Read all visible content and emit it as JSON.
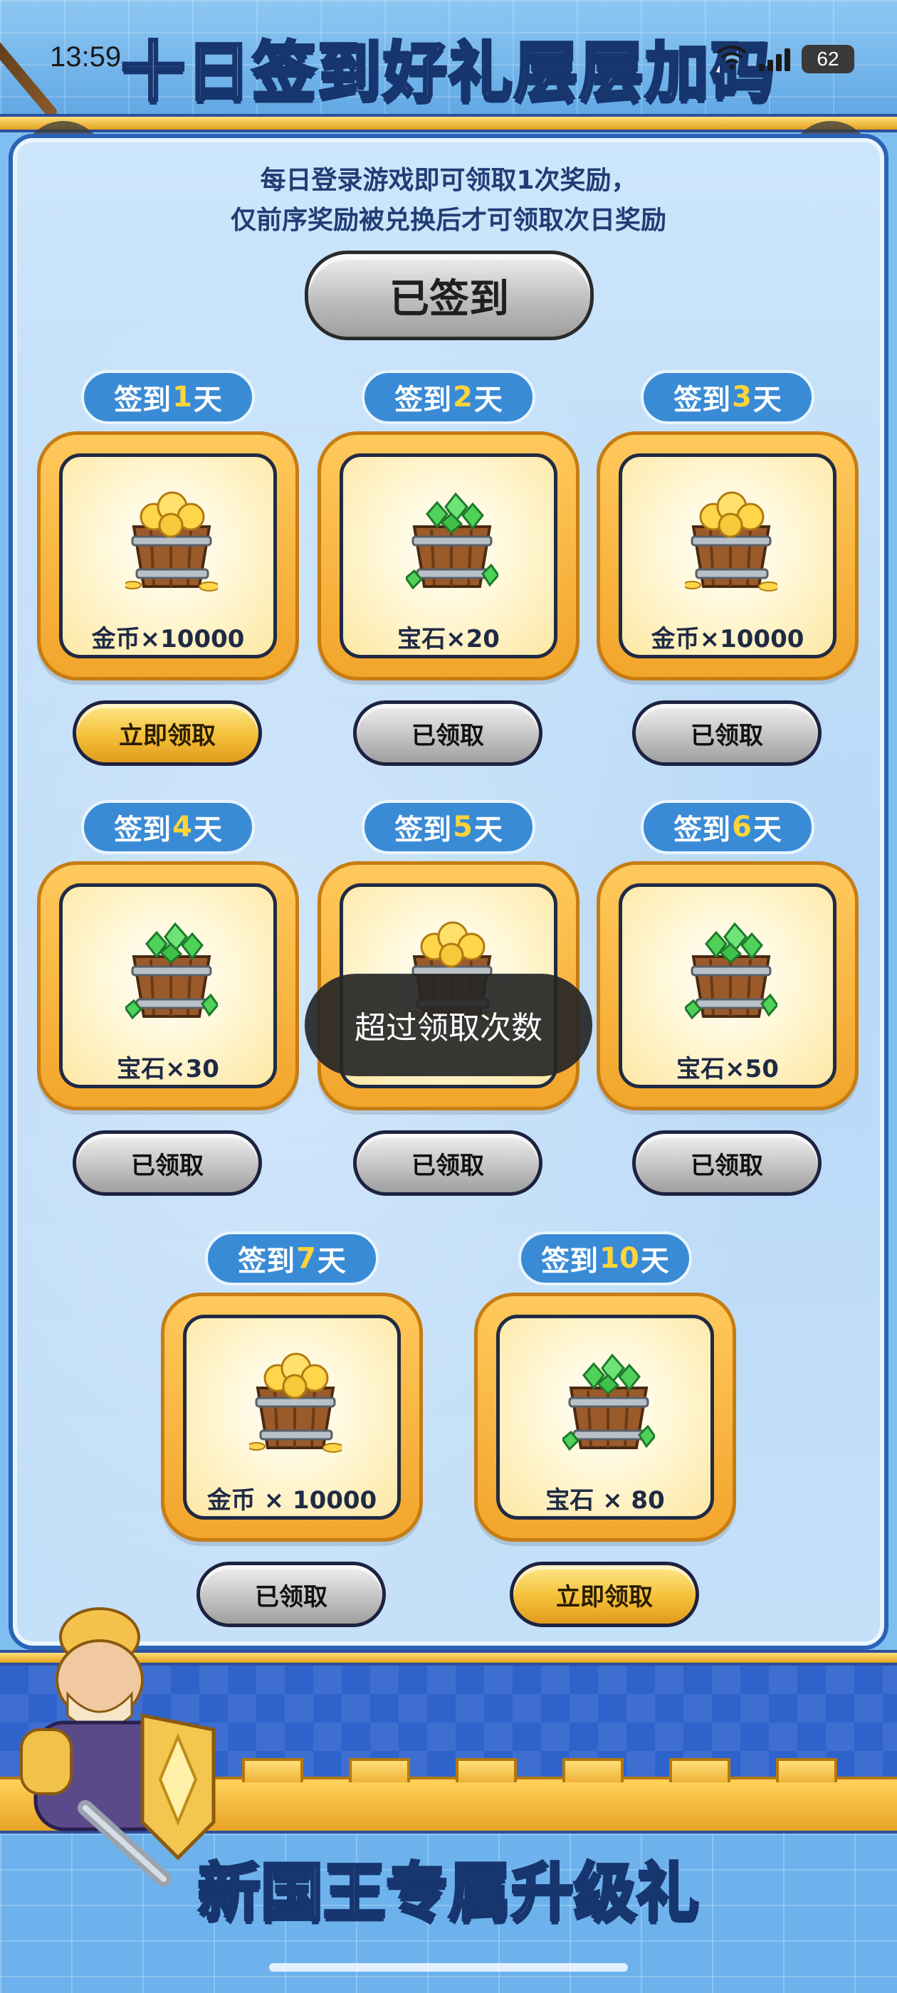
{
  "status_bar": {
    "time": "13:59",
    "battery": "62"
  },
  "banner": {
    "title": "十日签到好礼层层加码"
  },
  "notice": {
    "line1": "每日登录游戏即可领取1次奖励，",
    "line2": "仅前序奖励被兑换后才可领取次日奖励"
  },
  "signed_button": "已签到",
  "days": [
    {
      "prefix": "签到",
      "num": "1",
      "suffix": "天",
      "reward": "金币×10000",
      "type": "coin",
      "button": "立即领取",
      "state": "available"
    },
    {
      "prefix": "签到",
      "num": "2",
      "suffix": "天",
      "reward": "宝石×20",
      "type": "gem",
      "button": "已领取",
      "state": "claimed"
    },
    {
      "prefix": "签到",
      "num": "3",
      "suffix": "天",
      "reward": "金币×10000",
      "type": "coin",
      "button": "已领取",
      "state": "claimed"
    },
    {
      "prefix": "签到",
      "num": "4",
      "suffix": "天",
      "reward": "宝石×30",
      "type": "gem",
      "button": "已领取",
      "state": "claimed"
    },
    {
      "prefix": "签到",
      "num": "5",
      "suffix": "天",
      "reward": "",
      "type": "coin",
      "button": "已领取",
      "state": "claimed"
    },
    {
      "prefix": "签到",
      "num": "6",
      "suffix": "天",
      "reward": "宝石×50",
      "type": "gem",
      "button": "已领取",
      "state": "claimed"
    },
    {
      "prefix": "签到",
      "num": "7",
      "suffix": "天",
      "reward": "金币 × 10000",
      "type": "coin",
      "button": "已领取",
      "state": "claimed"
    },
    {
      "prefix": "签到",
      "num": "10",
      "suffix": "天",
      "reward": "宝石 × 80",
      "type": "gem",
      "button": "立即领取",
      "state": "available"
    }
  ],
  "toast": "超过领取次数",
  "bottom": {
    "title": "新国王专属升级礼"
  },
  "colors": {
    "gold_button": "#f4bf38",
    "grey_button": "#c4c4c4",
    "day_label_bg": "#3a8bd6",
    "day_number": "#ffd43a",
    "card_frame": "#f2a52b"
  },
  "icons": {
    "back": "chevron-left-icon",
    "share": "share-icon",
    "coin_bucket": "coin-bucket-icon",
    "gem_bucket": "gem-bucket-icon"
  }
}
